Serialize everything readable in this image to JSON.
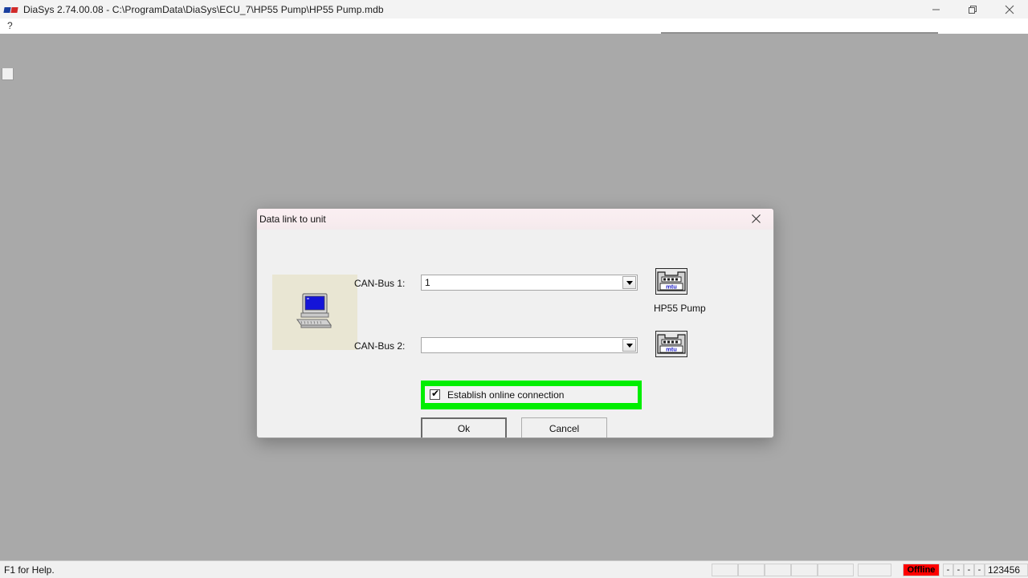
{
  "window": {
    "title": "DiaSys 2.74.00.08 - C:\\ProgramData\\DiaSys\\ECU_7\\HP55 Pump\\HP55 Pump.mdb",
    "minimize_label": "—",
    "maximize_label": "❐",
    "close_label": "✕"
  },
  "menu": {
    "help_label": "?"
  },
  "dialog": {
    "title": "Data link to unit",
    "close_label": "✕",
    "fields": [
      {
        "label": "CAN-Bus 1:",
        "value": "1"
      },
      {
        "label": "CAN-Bus 2:",
        "value": ""
      }
    ],
    "device_name": "HP55 Pump",
    "device_icon_label": "mtu",
    "online": {
      "label": "Establish online connection",
      "checked_glyph": "✔",
      "highlight_color": "#00ee00"
    },
    "buttons": {
      "ok": "Ok",
      "cancel": "Cancel"
    }
  },
  "status_bar": {
    "help_text": "F1 for Help.",
    "panes": [
      "",
      "",
      "",
      "",
      "",
      ""
    ],
    "connection_state": "Offline",
    "indicators": [
      "-",
      "-",
      "-",
      "-"
    ],
    "code": "123456"
  }
}
